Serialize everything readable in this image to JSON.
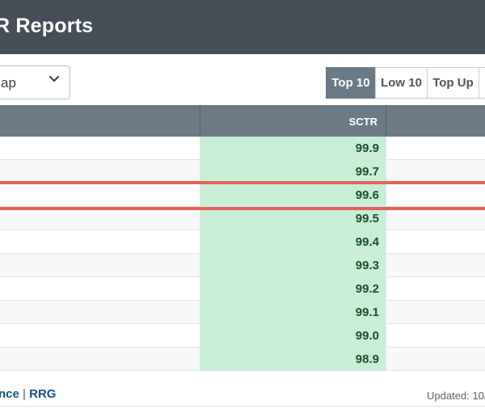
{
  "header": {
    "title": "R Reports"
  },
  "filter": {
    "value": "ap"
  },
  "tabs": [
    {
      "label": "Top 10",
      "active": true
    },
    {
      "label": "Low 10",
      "active": false
    },
    {
      "label": "Top Up",
      "active": false
    }
  ],
  "table": {
    "column_header": "SCTR",
    "rows": [
      {
        "sctr": "99.9"
      },
      {
        "sctr": "99.7"
      },
      {
        "sctr": "99.6",
        "highlighted": true
      },
      {
        "sctr": "99.5"
      },
      {
        "sctr": "99.4"
      },
      {
        "sctr": "99.3"
      },
      {
        "sctr": "99.2"
      },
      {
        "sctr": "99.1"
      },
      {
        "sctr": "99.0"
      },
      {
        "sctr": "98.9"
      }
    ]
  },
  "footer": {
    "link_a": "nce",
    "separator": "|",
    "link_b": "RRG",
    "updated": "Updated: 10/"
  },
  "colors": {
    "header_bg": "#464e58",
    "table_header_bg": "#6c7a86",
    "sctr_cell_bg": "#c6efd6",
    "highlight_line": "#e2625a",
    "link": "#1c4f86"
  }
}
